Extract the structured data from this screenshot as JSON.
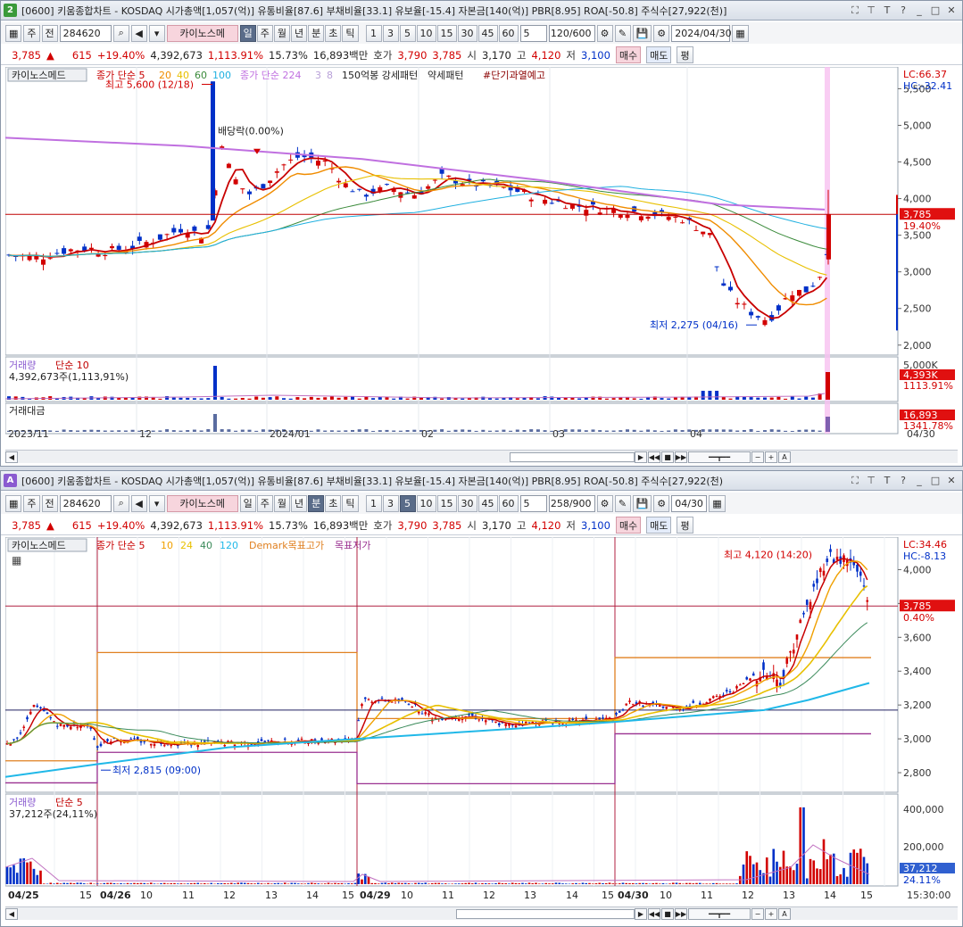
{
  "colors": {
    "up": "#d20000",
    "down": "#0030c8",
    "ma5": "#c80000",
    "ma20": "#f08c00",
    "ma40": "#e8c000",
    "ma60": "#3a8a3a",
    "ma100": "#20b0e0",
    "ma224": "#c070e0",
    "cursor": "#f7c0f0"
  },
  "top": {
    "window_number": "2",
    "title": "[0600] 키움종합차트 - KOSDAQ 시가총액[1,057(억)] 유통비율[87.6] 부채비율[33.1] 유보율[-15.4] 자본금[140(억)] PBR[8.95] ROA[-50.8] 주식수[27,922(천)]",
    "toolbar": {
      "type": "주",
      "type2": "전",
      "code": "284620",
      "stock_name": "카이노스메",
      "periods": [
        "일",
        "주",
        "월",
        "년",
        "분",
        "초",
        "틱"
      ],
      "active_period": "일",
      "nums": [
        "1",
        "3",
        "5",
        "10",
        "15",
        "30",
        "45",
        "60"
      ],
      "count": "5",
      "range": "120/600",
      "date": "2024/04/30"
    },
    "quote": {
      "price": "3,785",
      "arrow": "▲",
      "change": "615",
      "rate": "+19.40%",
      "volume": "4,392,673",
      "vol_rate": "1,113.91%",
      "turnover": "15.73%",
      "amount": "16,893백만",
      "hoga_label": "호가",
      "ask": "3,790",
      "bid": "3,785",
      "open_label": "시",
      "open": "3,170",
      "high_label": "고",
      "high": "4,120",
      "low_label": "저",
      "low": "3,100",
      "buy": "매수",
      "sell": "매도",
      "even": "평"
    },
    "legend": {
      "name": "카이노스메드",
      "ma_label": "종가 단순 5",
      "ma_nums": [
        "20",
        "40",
        "60",
        "100"
      ],
      "ma224": "종가 단순 224",
      "ma224_nums": [
        "3",
        "8"
      ],
      "pattern": "150억봉 강세패턴",
      "weak": "약세패턴",
      "warn": "#단기과열예고"
    },
    "lc": "LC:66.37",
    "hc": "HC:-32.41",
    "y_labels": [
      "5,500",
      "5,000",
      "4,500",
      "4,000",
      "3,500",
      "3,000",
      "2,500",
      "2,000"
    ],
    "price_tag": "3,785",
    "pct_tag": "19.40%",
    "max_label": "최고 5,600 (12/18)",
    "min_label": "최저 2,275 (04/16)",
    "dividend": "배당락(0.00%)",
    "vol_title": "거래량",
    "vol_ma": "단순 10",
    "vol_info": "4,392,673주(1,113,91%)",
    "vol_axis": "5,000K",
    "vol_tag": "4,393K",
    "vol_pct": "1113.91%",
    "amt_title": "거래대금",
    "amt_tag": "16,893",
    "amt_pct": "1341.78%",
    "x_labels": [
      "2023/11",
      "12",
      "2024/01",
      "02",
      "03",
      "04"
    ],
    "x_end": "04/30"
  },
  "bottom": {
    "window_number": "A",
    "title": "[0600] 키움종합차트 - KOSDAQ 시가총액[1,057(억)] 유통비율[87.6] 부채비율[33.1] 유보율[-15.4] 자본금[140(억)] PBR[8.95] ROA[-50.8] 주식수[27,922(천)",
    "toolbar": {
      "type": "주",
      "type2": "전",
      "code": "284620",
      "stock_name": "카이노스메",
      "periods": [
        "일",
        "주",
        "월",
        "년",
        "분",
        "초",
        "틱"
      ],
      "active_period": "분",
      "nums": [
        "1",
        "3",
        "5",
        "10",
        "15",
        "30",
        "45",
        "60"
      ],
      "active_num": "5",
      "count": "5",
      "range": "258/900",
      "date": "04/30"
    },
    "quote": {
      "price": "3,785",
      "arrow": "▲",
      "change": "615",
      "rate": "+19.40%",
      "volume": "4,392,673",
      "vol_rate": "1,113.91%",
      "turnover": "15.73%",
      "amount": "16,893백만",
      "hoga_label": "호가",
      "ask": "3,790",
      "bid": "3,785",
      "open_label": "시",
      "open": "3,170",
      "high_label": "고",
      "high": "4,120",
      "low_label": "저",
      "low": "3,100",
      "buy": "매수",
      "sell": "매도",
      "even": "평"
    },
    "legend": {
      "name": "카이노스메드",
      "ma_label": "종가 단순 5",
      "ma_nums": [
        "10",
        "24",
        "40",
        "120"
      ],
      "demark_high": "Demark목표고가",
      "demark_low": "목표저가"
    },
    "lc": "LC:34.46",
    "hc": "HC:-8.13",
    "y_labels": [
      "4,000",
      "3,800",
      "3,600",
      "3,400",
      "3,200",
      "3,000",
      "2,800"
    ],
    "price_tag": "3,785",
    "pct_tag": "0.40%",
    "max_label": "최고 4,120 (14:20)",
    "min_label": "최저 2,815 (09:00)",
    "vol_title": "거래량",
    "vol_ma": "단순 5",
    "vol_info": "37,212주(24,11%)",
    "vol_axis": [
      "400,000",
      "200,000"
    ],
    "vol_tag": "37,212",
    "vol_pct": "24.11%",
    "x_labels": [
      "04/25",
      "15",
      "04/26",
      "10",
      "11",
      "12",
      "13",
      "14",
      "15",
      "04/29",
      "10",
      "11",
      "12",
      "13",
      "14",
      "15",
      "04/30",
      "10",
      "11",
      "12",
      "13",
      "14",
      "15"
    ],
    "x_end": "15:30:00"
  }
}
